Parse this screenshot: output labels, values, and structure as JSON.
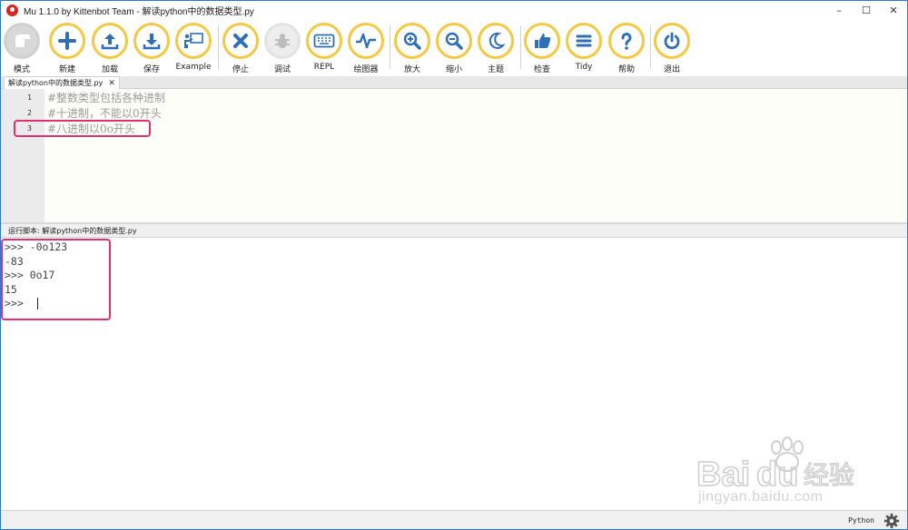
{
  "window": {
    "title": "Mu 1.1.0 by Kittenbot Team - 解读python中的数据类型.py",
    "controls": [
      "–",
      "☐",
      "✕"
    ]
  },
  "toolbar": {
    "buttons": [
      {
        "label": "模式",
        "icon": "mode-icon"
      },
      {
        "label": "新建",
        "icon": "plus-icon"
      },
      {
        "label": "加载",
        "icon": "upload-icon"
      },
      {
        "label": "保存",
        "icon": "download-icon"
      },
      {
        "label": "Example",
        "icon": "presentation-icon"
      },
      {
        "label": "停止",
        "icon": "x-icon"
      },
      {
        "label": "调试",
        "icon": "bug-icon"
      },
      {
        "label": "REPL",
        "icon": "keyboard-icon"
      },
      {
        "label": "绘图器",
        "icon": "pulse-icon"
      },
      {
        "label": "放大",
        "icon": "zoom-in-icon"
      },
      {
        "label": "缩小",
        "icon": "zoom-out-icon"
      },
      {
        "label": "主题",
        "icon": "moon-icon"
      },
      {
        "label": "检查",
        "icon": "thumbs-up-icon"
      },
      {
        "label": "Tidy",
        "icon": "lines-icon"
      },
      {
        "label": "帮助",
        "icon": "question-icon"
      },
      {
        "label": "退出",
        "icon": "power-icon"
      }
    ]
  },
  "tab": {
    "label": "解读python中的数据类型.py",
    "close": "✕"
  },
  "editor": {
    "lines": [
      {
        "num": "1",
        "text": "#整数类型包括各种进制"
      },
      {
        "num": "2",
        "text": "#十进制，不能以0开头"
      },
      {
        "num": "3",
        "text": "#八进制以0o开头"
      }
    ]
  },
  "repl": {
    "header": "运行脚本: 解读python中的数据类型.py",
    "lines": [
      ">>> -0o123",
      "-83",
      ">>> 0o17",
      "15",
      ">>> "
    ]
  },
  "watermark": {
    "text": "jingyan.baidu.com"
  },
  "status": {
    "mode": "Python",
    "settings_icon": "gear-icon"
  },
  "colors": {
    "accent": "#f5c842",
    "highlight": "#e0306f",
    "icon_blue": "#2e6fb5"
  }
}
